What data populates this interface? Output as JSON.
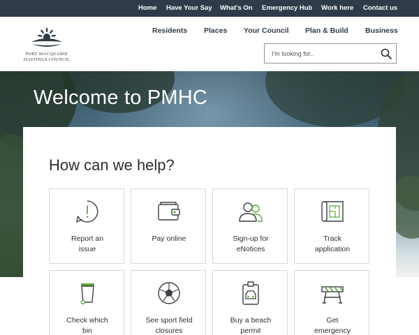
{
  "top_nav": [
    "Home",
    "Have Your Say",
    "What's On",
    "Emergency Hub",
    "Work here",
    "Contact us"
  ],
  "logo": {
    "line1": "PORT MACQUARIE",
    "line2": "HASTINGS COUNCIL"
  },
  "main_nav": [
    "Residents",
    "Places",
    "Your Council",
    "Plan & Build",
    "Business"
  ],
  "search": {
    "placeholder": "I'm looking for..",
    "icon": "magnifier-icon"
  },
  "hero": {
    "title": "Welcome to PMHC"
  },
  "help": {
    "title": "How can we help?",
    "cards": [
      {
        "line1": "Report an",
        "line2": "issue",
        "icon": "alert-speech-bubble-icon"
      },
      {
        "line1": "Pay online",
        "line2": "",
        "icon": "wallet-icon"
      },
      {
        "line1": "Sign-up for",
        "line2": "eNotices",
        "icon": "users-icon"
      },
      {
        "line1": "Track",
        "line2": "application",
        "icon": "blueprint-icon"
      },
      {
        "line1": "Check which",
        "line2": "bin",
        "icon": "wheelie-bin-icon"
      },
      {
        "line1": "See sport field",
        "line2": "closures",
        "icon": "soccer-ball-icon"
      },
      {
        "line1": "Buy a beach",
        "line2": "permit",
        "icon": "vehicle-permit-icon"
      },
      {
        "line1": "Get",
        "line2": "emergency",
        "icon": "road-barrier-icon"
      }
    ]
  },
  "colors": {
    "topbar": "#2f3b48",
    "icon_dark": "#3a3f44",
    "icon_accent": "#5aa83a"
  }
}
